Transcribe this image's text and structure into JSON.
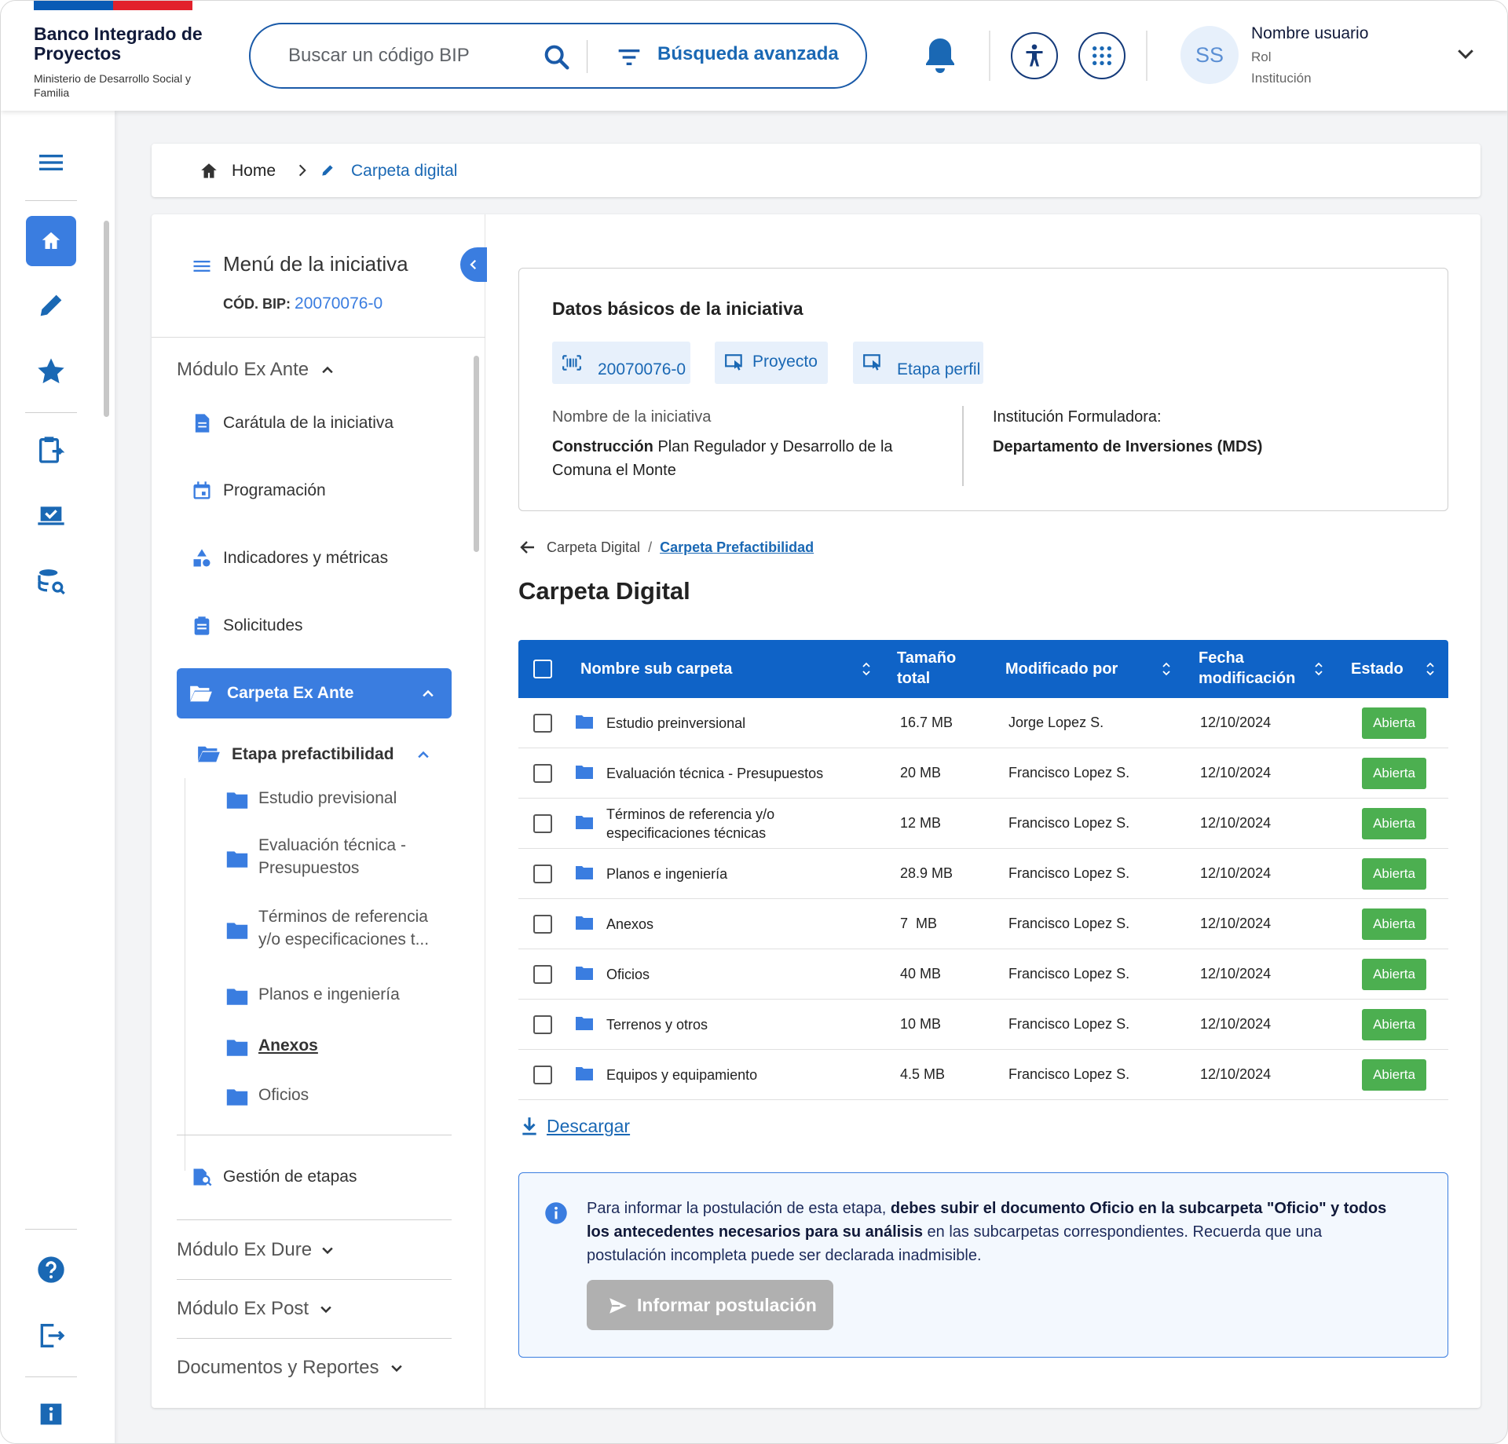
{
  "header": {
    "logo_title": "Banco Integrado de Proyectos",
    "logo_sub": "Ministerio de Desarrollo Social y Familia",
    "search_placeholder": "Buscar un código BIP",
    "advanced_label": "Búsqueda avanzada",
    "user_initials": "SS",
    "user_name": "Nombre usuario",
    "user_role": "Rol",
    "user_institution": "Institución"
  },
  "colors": {
    "primary": "#0f63c7",
    "accent": "#3a7de0",
    "badge_green": "#4caf50",
    "flag_blue": "#0a5bb5",
    "flag_red": "#e2212c"
  },
  "rail": {
    "icons": [
      "menu-icon",
      "home-icon",
      "pencil-icon",
      "star-icon",
      "clipboard-swap-icon",
      "laptop-check-icon",
      "database-search-icon",
      "help-icon",
      "logout-icon",
      "info-icon"
    ]
  },
  "breadcrumb": {
    "home": "Home",
    "current": "Carpeta digital"
  },
  "menu": {
    "title": "Menú de la iniciativa",
    "bip_label": "CÓD. BIP:",
    "bip_value": "20070076-0",
    "module_ex_ante": "Módulo Ex Ante",
    "items": [
      "Carátula de la iniciativa",
      "Programación",
      "Indicadores y métricas",
      "Solicitudes"
    ],
    "active": "Carpeta Ex Ante",
    "stage": "Etapa prefactibilidad",
    "subfolders": [
      "Estudio previsional",
      "Evaluación técnica - Presupuestos",
      "Términos de referencia y/o especificaciones t...",
      "Planos e ingeniería",
      "Anexos",
      "Oficios"
    ],
    "gestion": "Gestión de etapas",
    "module_ex_dure": "Módulo Ex Dure",
    "module_ex_post": "Módulo Ex Post",
    "docs_reports": "Documentos y Reportes"
  },
  "basics": {
    "title": "Datos básicos de la iniciativa",
    "chip_code": "20070076-0",
    "chip_type": "Proyecto",
    "chip_stage": "Etapa perfil",
    "name_label": "Nombre de la iniciativa",
    "name_bold": "Construcción",
    "name_rest": " Plan Regulador y Desarrollo de la Comuna el Monte",
    "inst_label": "Institución Formuladora:",
    "inst_value": "Departamento de Inversiones (MDS)"
  },
  "folder_nav": {
    "parent": "Carpeta Digital",
    "separator": "/",
    "current": "Carpeta Prefactibilidad"
  },
  "page_title": "Carpeta Digital",
  "table": {
    "headers": {
      "name": "Nombre sub carpeta",
      "size": "Tamaño total",
      "modified_by": "Modificado por",
      "date": "Fecha modificación",
      "status": "Estado"
    },
    "rows": [
      {
        "name": "Estudio preinversional",
        "size": "16.7 MB",
        "by": "Jorge Lopez S.",
        "date": "12/10/2024",
        "status": "Abierta"
      },
      {
        "name": "Evaluación técnica - Presupuestos",
        "size": "20 MB",
        "by": "Francisco Lopez S.",
        "date": "12/10/2024",
        "status": "Abierta"
      },
      {
        "name": "Términos de referencia y/o especificaciones técnicas",
        "size": "12 MB",
        "by": "Francisco Lopez S.",
        "date": "12/10/2024",
        "status": "Abierta"
      },
      {
        "name": "Planos e ingeniería",
        "size": "28.9 MB",
        "by": "Francisco Lopez S.",
        "date": "12/10/2024",
        "status": "Abierta"
      },
      {
        "name": "Anexos",
        "size": "7  MB",
        "by": "Francisco Lopez S.",
        "date": "12/10/2024",
        "status": "Abierta"
      },
      {
        "name": "Oficios",
        "size": "40 MB",
        "by": "Francisco Lopez S.",
        "date": "12/10/2024",
        "status": "Abierta"
      },
      {
        "name": "Terrenos y otros",
        "size": "10 MB",
        "by": "Francisco Lopez S.",
        "date": "12/10/2024",
        "status": "Abierta"
      },
      {
        "name": "Equipos y equipamiento",
        "size": "4.5 MB",
        "by": "Francisco Lopez S.",
        "date": "12/10/2024",
        "status": "Abierta"
      }
    ]
  },
  "download_label": "Descargar",
  "info": {
    "text_a": "Para informar la postulación de esta etapa, ",
    "text_bold": "debes subir el documento Oficio en la subcarpeta \"Oficio\" y todos los antecedentes necesarios para su análisis",
    "text_b": " en las subcarpetas correspondientes. Recuerda que una postulación incompleta puede ser declarada inadmisible.",
    "button": "Informar postulación"
  }
}
